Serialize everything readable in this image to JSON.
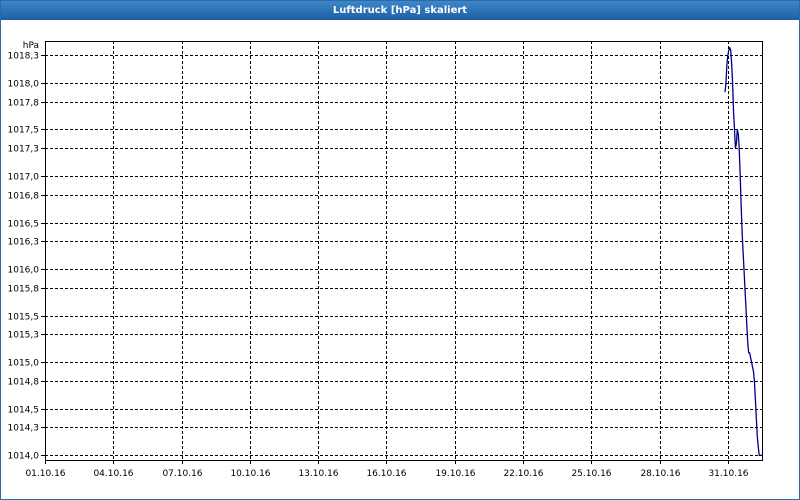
{
  "window": {
    "title": "Luftdruck [hPa] skaliert"
  },
  "chart_data": {
    "type": "line",
    "title": "Luftdruck [hPa] skaliert",
    "ylabel": "hPa",
    "xlabel": "",
    "grid": true,
    "legend": "none",
    "ylim": [
      1013.95,
      1018.45
    ],
    "xlim": [
      "01.10.16",
      "01.11.16 12:00"
    ],
    "yticks": [
      "1018,3",
      "1018,0",
      "1017,8",
      "1017,5",
      "1017,3",
      "1017,0",
      "1016,8",
      "1016,5",
      "1016,3",
      "1016,0",
      "1015,8",
      "1015,5",
      "1015,3",
      "1015,0",
      "1014,8",
      "1014,5",
      "1014,3",
      "1014,0"
    ],
    "xticks": [
      "01.10.16",
      "04.10.16",
      "07.10.16",
      "10.10.16",
      "13.10.16",
      "16.10.16",
      "19.10.16",
      "22.10.16",
      "25.10.16",
      "28.10.16",
      "31.10.16"
    ],
    "series": [
      {
        "color": "#00008b",
        "x": [
          "30.10.16 21:00",
          "30.10.16 22:00",
          "30.10.16 23:00",
          "31.10.16 00:00",
          "31.10.16 01:00",
          "31.10.16 02:00",
          "31.10.16 03:00",
          "31.10.16 04:00",
          "31.10.16 05:00",
          "31.10.16 06:00",
          "31.10.16 07:00",
          "31.10.16 08:00",
          "31.10.16 09:00",
          "31.10.16 10:00",
          "31.10.16 11:00",
          "31.10.16 12:00",
          "31.10.16 13:00",
          "31.10.16 14:00",
          "31.10.16 15:00",
          "31.10.16 16:00",
          "31.10.16 17:00",
          "31.10.16 18:00",
          "31.10.16 19:00",
          "31.10.16 20:00",
          "31.10.16 21:00",
          "31.10.16 22:00",
          "31.10.16 23:00",
          "01.11.16 00:00",
          "01.11.16 01:00",
          "01.11.16 02:00",
          "01.11.16 03:00",
          "01.11.16 04:00",
          "01.11.16 05:00",
          "01.11.16 06:00",
          "01.11.16 07:00",
          "01.11.16 08:00",
          "01.11.16 09:00",
          "01.11.16 10:00",
          "01.11.16 11:00",
          "01.11.16 12:00"
        ],
        "y": [
          1017.9,
          1018.0,
          1018.2,
          1018.3,
          1018.35,
          1018.38,
          1018.35,
          1018.2,
          1018.0,
          1017.7,
          1017.5,
          1017.3,
          1017.35,
          1017.5,
          1017.45,
          1017.3,
          1017.0,
          1016.7,
          1016.4,
          1016.2,
          1016.0,
          1015.8,
          1015.6,
          1015.4,
          1015.2,
          1015.1,
          1015.1,
          1015.05,
          1015.0,
          1014.95,
          1014.9,
          1014.8,
          1014.6,
          1014.4,
          1014.2,
          1014.1,
          1014.0,
          1014.0,
          1014.0,
          1014.0
        ]
      }
    ]
  }
}
